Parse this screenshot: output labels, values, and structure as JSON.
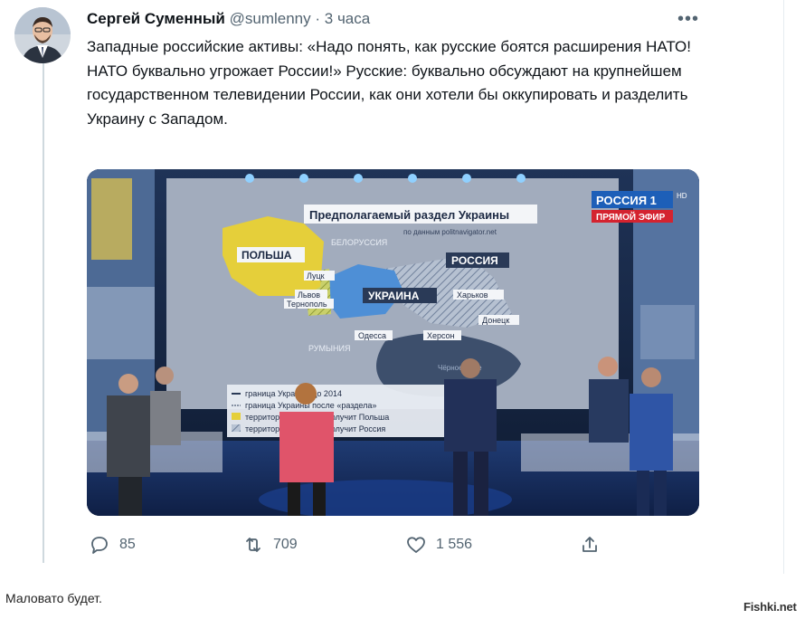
{
  "tweet": {
    "author_name": "Сергей Суменный",
    "handle": "@sumlenny",
    "separator": "·",
    "time": "3 часа",
    "text": "Западные российские активы: «Надо понять, как русские боятся расширения НАТО! НАТО буквально угрожает России!» Русские: буквально обсуждают на крупнейшем государственном телевидении России, как они хотели бы оккупировать и разделить Украину с Западом."
  },
  "media": {
    "map_title": "Предполагаемый раздел Украины",
    "map_source": "по данным politnavigator.net",
    "channel_logo": "РОССИЯ 1",
    "channel_hd": "HD",
    "live_badge": "ПРЯМОЙ ЭФИР",
    "countries": {
      "poland": "ПОЛЬША",
      "belarus": "БЕЛОРУССИЯ",
      "russia": "РОССИЯ",
      "ukraine": "УКРАИНА",
      "romania": "РУМЫНИЯ",
      "black_sea": "Чёрное море"
    },
    "cities": [
      "Луцк",
      "Львов",
      "Тернополь",
      "Харьков",
      "Донецк",
      "Одесса",
      "Херсон"
    ],
    "legend": [
      "граница Украины до 2014",
      "граница Украины после «раздела»",
      "территории, которые получит Польша",
      "территории, которые получит Россия"
    ]
  },
  "actions": {
    "replies": "85",
    "retweets": "709",
    "likes": "1 556"
  },
  "caption": "Маловато будет.",
  "watermark": "Fishki.net",
  "icons": [
    "more-icon",
    "reply-icon",
    "retweet-icon",
    "like-icon",
    "share-icon"
  ],
  "colors": {
    "text": "#0f1419",
    "secondary": "#536471",
    "poland_fill": "#e5cf3a",
    "ukraine_fill": "#4e8fd6",
    "russia_fill": "#a7b2c3"
  }
}
